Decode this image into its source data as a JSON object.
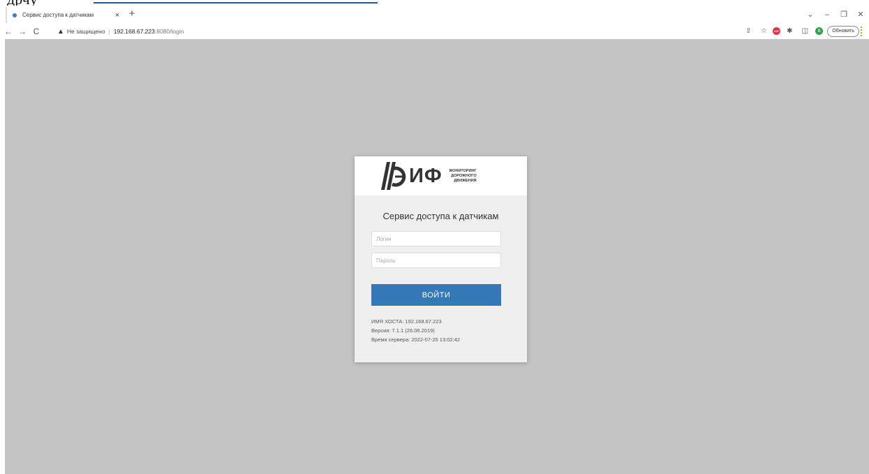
{
  "document_fragment": {
    "text": "дрчу"
  },
  "tab": {
    "title": "Сервис доступа к датчикам",
    "close": "×",
    "new_tab": "+"
  },
  "window_controls": {
    "tab_search": "⌄",
    "minimize": "–",
    "restore": "❐",
    "close": "✕"
  },
  "toolbar": {
    "back": "←",
    "forward": "→",
    "reload": "C",
    "security_warning": "Не защищено",
    "separator": "|",
    "url_host": "192.168.67.223",
    "url_path": ":8080/login",
    "update_label": "Обновить",
    "avatar_initial": "В",
    "adblock_label": "ABP",
    "share_icon": "⇪",
    "star_icon": "☆",
    "extensions_icon": "✱",
    "sidepanel_icon": "◫"
  },
  "logo": {
    "word": "ИФ",
    "sub_line1": "МОНИТОРИНГ",
    "sub_line2": "ДОРОЖНОГО",
    "sub_line3": "ДВИЖЕНИЯ"
  },
  "login": {
    "title": "Сервис доступа к датчикам",
    "login_placeholder": "Логин",
    "password_placeholder": "Пароль",
    "submit_label": "ВОЙТИ"
  },
  "info": {
    "hostname": "ИМЯ ХОСТА: 192.168.67.223",
    "version": "Версия: 7.1.1 (26.06.2019)",
    "server_time": "Время сервера: 2022-07-25 13:02:42"
  },
  "colors": {
    "page_background": "#c4c4c4",
    "button": "#3478b8",
    "card": "#efefef"
  }
}
